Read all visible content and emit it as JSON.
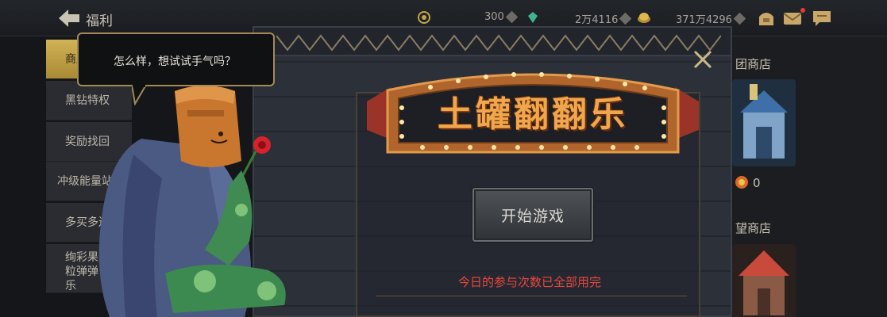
{
  "header": {
    "title": "福利",
    "resources": [
      {
        "name": "coin",
        "value": "300"
      },
      {
        "name": "gem",
        "value": "2万4116"
      },
      {
        "name": "gold",
        "value": "371万4296"
      }
    ]
  },
  "sidebar": {
    "items": [
      {
        "label": "商店扶持"
      },
      {
        "label": "黑钻特权"
      },
      {
        "label": "奖励找回"
      },
      {
        "label": "冲级能量站"
      },
      {
        "label": "多买多送"
      },
      {
        "label": "绚彩果粒弹弹乐"
      }
    ]
  },
  "shops": [
    {
      "title": "团商店",
      "count": "0"
    },
    {
      "title": "望商店"
    }
  ],
  "speech": {
    "text": "怎么样，想试试手气吗？"
  },
  "game": {
    "title": "土罐翻翻乐",
    "start_label": "开始游戏",
    "status": "今日的参与次数已全部用完"
  },
  "colors": {
    "accent_gold": "#d1b255",
    "status_red": "#e8473e",
    "title_orange": "#f0a64a"
  }
}
